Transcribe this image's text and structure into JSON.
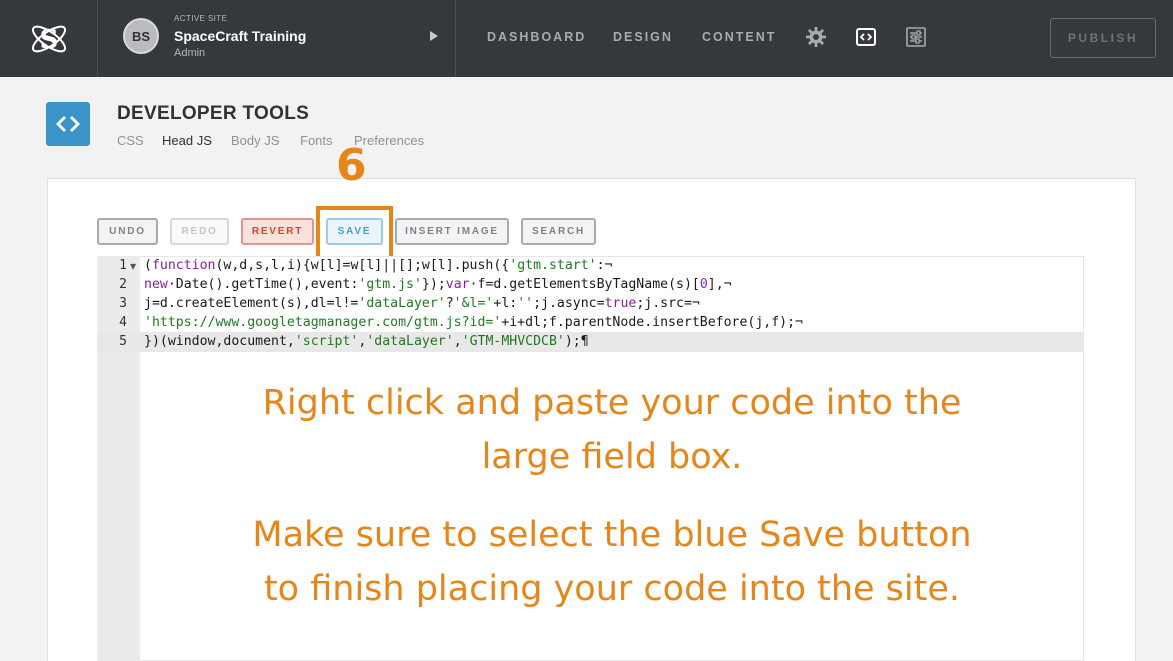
{
  "topbar": {
    "logo_icon": "spacecraft-s-logo-icon",
    "site": {
      "avatar_initials": "BS",
      "kicker": "ACTIVE SITE",
      "name": "SpaceCraft Training",
      "role": "Admin"
    },
    "nav": [
      "DASHBOARD",
      "DESIGN",
      "CONTENT"
    ],
    "icons": [
      "gear-icon",
      "code-icon",
      "sliders-icon"
    ],
    "publish_label": "PUBLISH"
  },
  "header": {
    "title": "DEVELOPER TOOLS",
    "tabs": [
      "CSS",
      "Head JS",
      "Body JS",
      "Fonts",
      "Preferences"
    ],
    "active_tab": "Head JS"
  },
  "step_number": "6",
  "toolbar": {
    "undo": "UNDO",
    "redo": "REDO",
    "revert": "REVERT",
    "save": "SAVE",
    "insert_image": "INSERT IMAGE",
    "search": "SEARCH"
  },
  "editor": {
    "line_numbers": [
      "1",
      "2",
      "3",
      "4",
      "5"
    ],
    "active_line": 5
  },
  "instructions": {
    "line1": "Right click and paste your code into the",
    "line2": "large field box.",
    "line3": "Make sure to select the blue Save button",
    "line4": "to finish placing your code into the site."
  },
  "colors": {
    "accent_orange": "#e6861a",
    "brand_blue": "#3b95c9",
    "topbar_bg": "#35383c"
  }
}
